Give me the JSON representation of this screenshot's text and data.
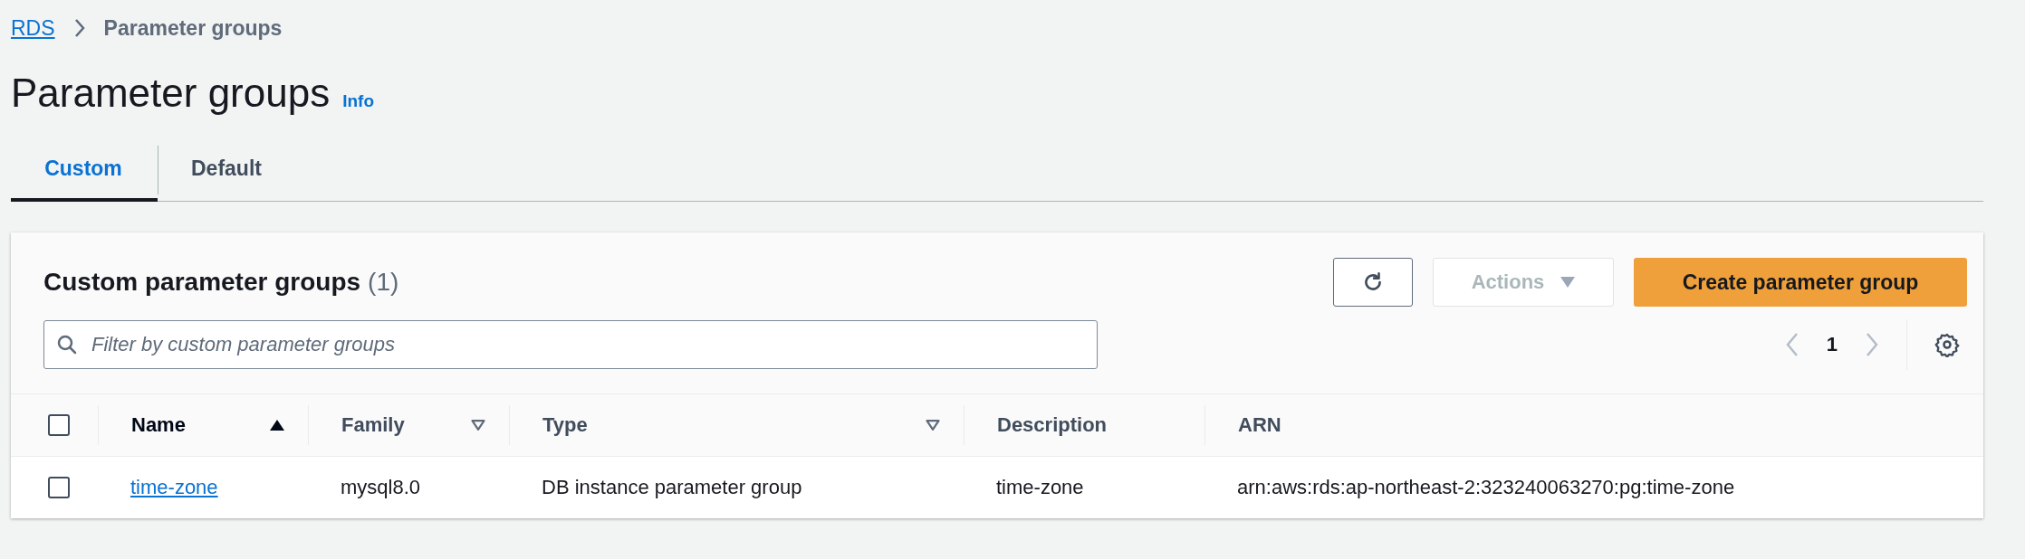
{
  "breadcrumb": [
    {
      "label": "RDS",
      "kind": "link"
    },
    {
      "label": "Parameter groups",
      "kind": "current"
    }
  ],
  "page_title": "Parameter groups",
  "info_link": "Info",
  "tabs": [
    {
      "label": "Custom",
      "selected": true
    },
    {
      "label": "Default",
      "selected": false
    }
  ],
  "panel": {
    "title": "Custom parameter groups",
    "count": "(1)",
    "actions": {
      "label": "Actions",
      "disabled": true
    },
    "create_button": "Create parameter group",
    "filter": {
      "placeholder": "Filter by custom parameter groups"
    },
    "pagination": {
      "page": "1"
    }
  },
  "table": {
    "columns": [
      {
        "label": "Name",
        "kind": "sorted"
      },
      {
        "label": "Family",
        "kind": "sortable"
      },
      {
        "label": "Type",
        "kind": "sortable"
      },
      {
        "label": "Description",
        "kind": "plain"
      },
      {
        "label": "ARN",
        "kind": "plain"
      }
    ],
    "header_checked": false,
    "rows": [
      {
        "checked": false,
        "name": "time-zone",
        "family": "mysql8.0",
        "type": "DB instance parameter group",
        "description": "time-zone",
        "arn": "arn:aws:rds:ap-northeast-2:323240063270:pg:time-zone"
      }
    ]
  }
}
